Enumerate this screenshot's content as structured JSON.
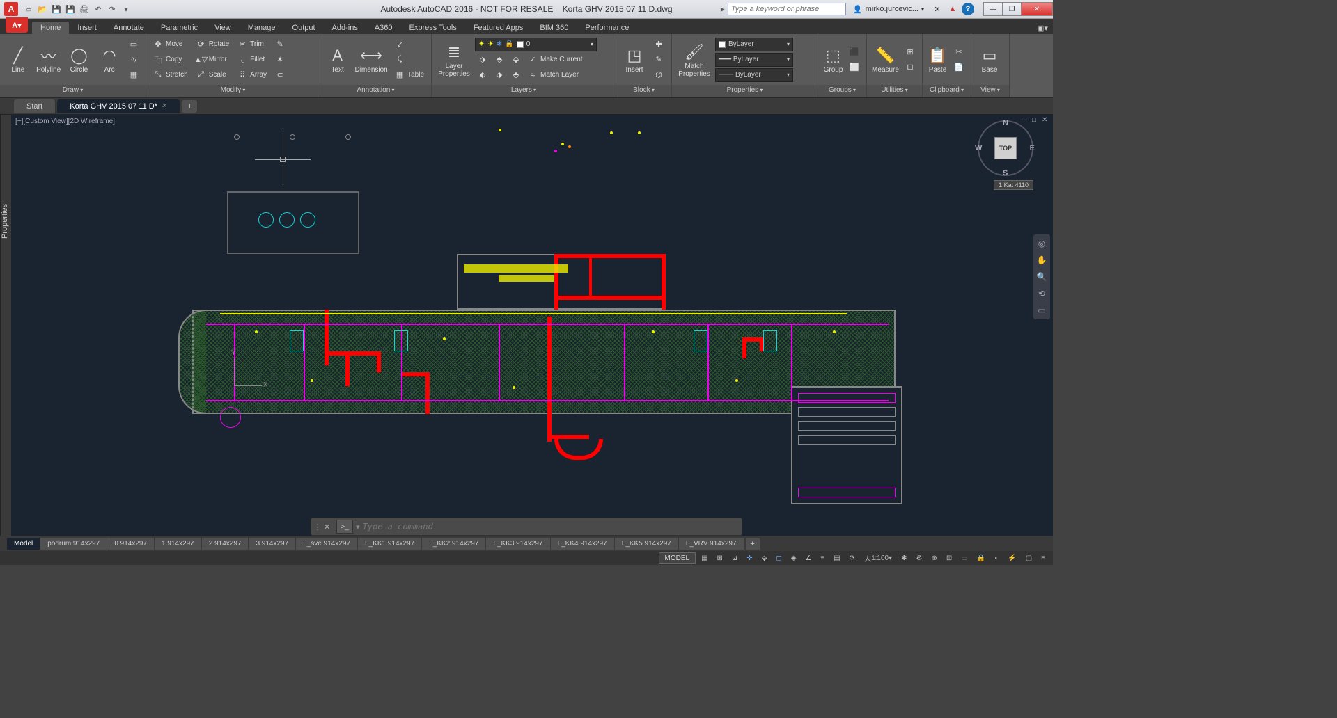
{
  "title": {
    "app": "Autodesk AutoCAD 2016 - NOT FOR RESALE",
    "file": "Korta GHV 2015 07 11 D.dwg"
  },
  "search": {
    "placeholder": "Type a keyword or phrase"
  },
  "user": {
    "name": "mirko.jurcevic..."
  },
  "ribbon_tabs": [
    "Home",
    "Insert",
    "Annotate",
    "Parametric",
    "View",
    "Manage",
    "Output",
    "Add-ins",
    "A360",
    "Express Tools",
    "Featured Apps",
    "BIM 360",
    "Performance"
  ],
  "active_ribbon_tab": "Home",
  "panels": {
    "draw": {
      "title": "Draw",
      "line": "Line",
      "polyline": "Polyline",
      "circle": "Circle",
      "arc": "Arc"
    },
    "modify": {
      "title": "Modify",
      "move": "Move",
      "copy": "Copy",
      "stretch": "Stretch",
      "rotate": "Rotate",
      "mirror": "Mirror",
      "scale": "Scale",
      "trim": "Trim",
      "fillet": "Fillet",
      "array": "Array"
    },
    "annotation": {
      "title": "Annotation",
      "text": "Text",
      "dimension": "Dimension",
      "table": "Table"
    },
    "layers": {
      "title": "Layers",
      "layer_properties": "Layer\nProperties",
      "make_current": "Make Current",
      "match_layer": "Match Layer",
      "current": "0"
    },
    "block": {
      "title": "Block",
      "insert": "Insert"
    },
    "properties": {
      "title": "Properties",
      "match": "Match\nProperties",
      "bylayer": "ByLayer"
    },
    "groups": {
      "title": "Groups",
      "group": "Group"
    },
    "utilities": {
      "title": "Utilities",
      "measure": "Measure"
    },
    "clipboard": {
      "title": "Clipboard",
      "paste": "Paste"
    },
    "view": {
      "title": "View",
      "base": "Base"
    }
  },
  "file_tabs": {
    "start": "Start",
    "doc": "Korta GHV 2015 07 11 D*"
  },
  "view_label": "[−][Custom View][2D Wireframe]",
  "viewcube": {
    "face": "TOP",
    "n": "N",
    "s": "S",
    "e": "E",
    "w": "W"
  },
  "wcs_label": "1:Kat 4110",
  "properties_palette": "Properties",
  "command": {
    "placeholder": "Type a command"
  },
  "layout_tabs": [
    "Model",
    "podrum 914x297",
    "0 914x297",
    "1 914x297",
    "2 914x297",
    "3 914x297",
    "L_sve 914x297",
    "L_KK1 914x297",
    "L_KK2 914x297",
    "L_KK3 914x297",
    "L_KK4 914x297",
    "L_KK5 914x297",
    "L_VRV 914x297"
  ],
  "status": {
    "model": "MODEL",
    "scale": "1:100"
  },
  "ucs": {
    "x": "X",
    "y": "Y"
  }
}
